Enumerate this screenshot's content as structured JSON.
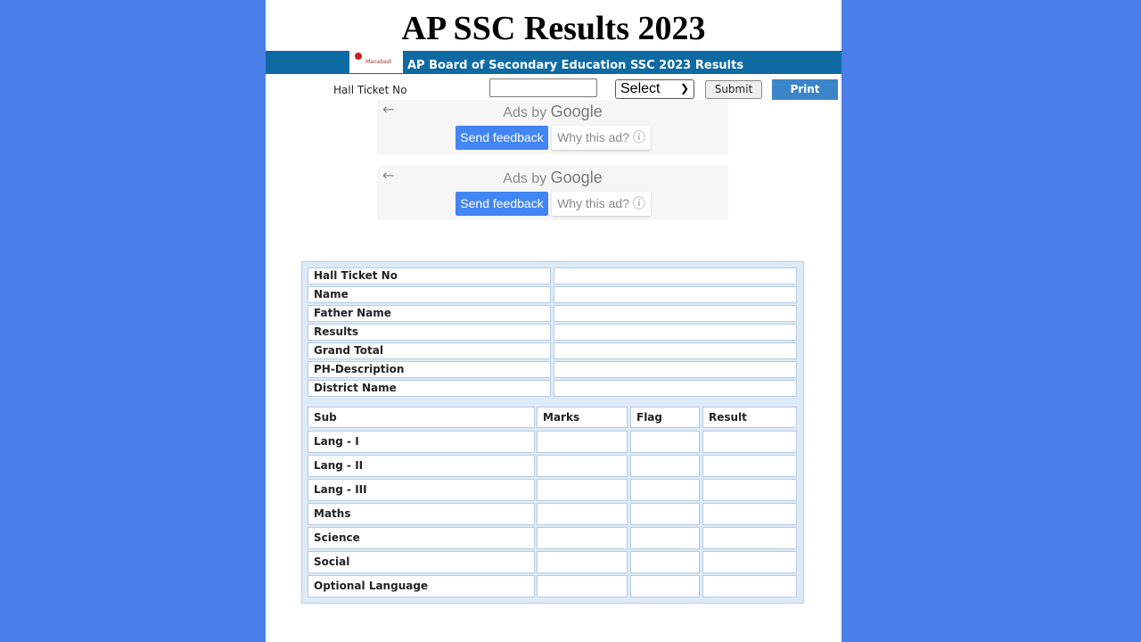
{
  "header": {
    "title": "AP SSC Results 2023",
    "banner_text": "AP Board of Secondary Education SSC 2023 Results",
    "logo_icon": "site-logo"
  },
  "form": {
    "hall_ticket_label": "Hall Ticket No",
    "hall_ticket_value": "",
    "select_value": "Select",
    "submit_label": "Submit",
    "print_label": "Print"
  },
  "ads": [
    {
      "back_icon": "arrow-left-icon",
      "ads_by": "Ads by",
      "google": "Google",
      "feedback_label": "Send feedback",
      "why_label": "Why this ad?",
      "info_icon": "info-icon"
    },
    {
      "back_icon": "arrow-left-icon",
      "ads_by": "Ads by",
      "google": "Google",
      "feedback_label": "Send feedback",
      "why_label": "Why this ad?",
      "info_icon": "info-icon"
    }
  ],
  "student_info": {
    "rows": [
      {
        "label": "Hall Ticket No",
        "value": ""
      },
      {
        "label": "Name",
        "value": ""
      },
      {
        "label": "Father Name",
        "value": ""
      },
      {
        "label": "Results",
        "value": ""
      },
      {
        "label": "Grand Total",
        "value": ""
      },
      {
        "label": "PH-Description",
        "value": ""
      },
      {
        "label": "District Name",
        "value": ""
      }
    ]
  },
  "marks_table": {
    "headers": [
      "Sub",
      "Marks",
      "Flag",
      "Result"
    ],
    "rows": [
      {
        "sub": "Lang - I",
        "marks": "",
        "flag": "",
        "result": ""
      },
      {
        "sub": "Lang - II",
        "marks": "",
        "flag": "",
        "result": ""
      },
      {
        "sub": "Lang - III",
        "marks": "",
        "flag": "",
        "result": ""
      },
      {
        "sub": "Maths",
        "marks": "",
        "flag": "",
        "result": ""
      },
      {
        "sub": "Science",
        "marks": "",
        "flag": "",
        "result": ""
      },
      {
        "sub": "Social",
        "marks": "",
        "flag": "",
        "result": ""
      },
      {
        "sub": "Optional Language",
        "marks": "",
        "flag": "",
        "result": ""
      }
    ]
  }
}
